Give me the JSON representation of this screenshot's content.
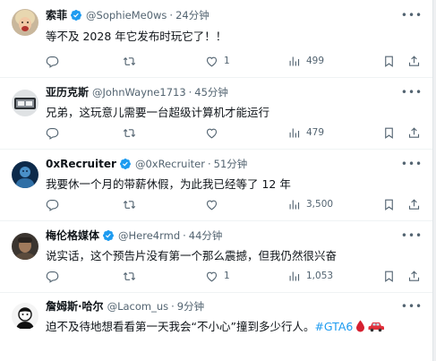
{
  "tweets": [
    {
      "name": "索菲",
      "handle": "@SophieMe0ws",
      "separator": "·",
      "time": "24分钟",
      "text": "等不及 2028 年它发布时玩它了！！",
      "reply_count": "",
      "retweet_count": "",
      "like_count": "1",
      "view_count": "499"
    },
    {
      "name": "亚历克斯",
      "handle": "@JohnWayne1713",
      "separator": "·",
      "time": "45分钟",
      "text": "兄弟，这玩意儿需要一台超级计算机才能运行",
      "reply_count": "",
      "retweet_count": "",
      "like_count": "",
      "view_count": "479"
    },
    {
      "name": "0xRecruiter",
      "handle": "@0xRecruiter",
      "separator": "·",
      "time": "51分钟",
      "text": "我要休一个月的带薪休假，为此我已经等了 12 年",
      "reply_count": "",
      "retweet_count": "",
      "like_count": "",
      "view_count": "3,500"
    },
    {
      "name": "梅伦格媒体",
      "handle": "@Here4rmd",
      "separator": "·",
      "time": "44分钟",
      "text": "说实话，这个预告片没有第一个那么震撼，但我仍然很兴奋",
      "reply_count": "",
      "retweet_count": "",
      "like_count": "1",
      "view_count": "1,053"
    },
    {
      "name": "詹姆斯·哈尔",
      "handle": "@Lacom_us",
      "separator": "·",
      "time": "9分钟",
      "text": "迫不及待地想看看第一天我会“不小心”撞到多少行人。",
      "hashtag": "#GTA6",
      "emojis": [
        "blood-drop-emoji",
        "red-car-emoji"
      ]
    }
  ],
  "colors": {
    "text": "#0f1419",
    "secondary": "#536471",
    "link": "#1d9bf0",
    "verified": "#1d9bf0",
    "divider": "#eff3f4"
  }
}
